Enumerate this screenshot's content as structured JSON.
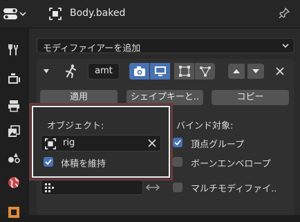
{
  "header": {
    "editor_icon": "properties-editor-icon",
    "object_icon": "object-icon",
    "object_name": "Body.baked",
    "pin_icon": "pin-icon"
  },
  "tabs": [
    {
      "icon": "tool-icon"
    },
    {
      "icon": "render-icon"
    },
    {
      "icon": "output-icon"
    },
    {
      "icon": "view-layer-icon"
    },
    {
      "icon": "scene-icon"
    },
    {
      "icon": "world-icon"
    },
    {
      "icon": "object-icon"
    }
  ],
  "add_modifier": {
    "label": "モディファイアーを追加"
  },
  "modifier": {
    "name": "amt",
    "type_icon": "armature-icon",
    "toggles": [
      {
        "icon": "camera-icon",
        "active": true
      },
      {
        "icon": "monitor-icon",
        "active": true
      },
      {
        "icon": "edit-mode-icon",
        "active": false
      },
      {
        "icon": "cage-icon",
        "active": false
      }
    ],
    "buttons": {
      "apply": "適用",
      "shape_key": "シェイプキーと..",
      "copy": "コピー"
    },
    "object_label": "オブジェクト:",
    "object_value": "rig",
    "preserve_volume": {
      "label": "体積を維持",
      "checked": true
    },
    "bind_to_label": "バインド対象:",
    "vertex_groups": {
      "label": "頂点グループ",
      "checked": true
    },
    "bone_envelopes": {
      "label": "ボーンエンベロープ",
      "checked": false
    },
    "multi_modifier": {
      "label": "マルチモディファイ..",
      "checked": false
    }
  },
  "colors": {
    "accent": "#4772b3",
    "highlight_frame": "#6a3a3a"
  }
}
